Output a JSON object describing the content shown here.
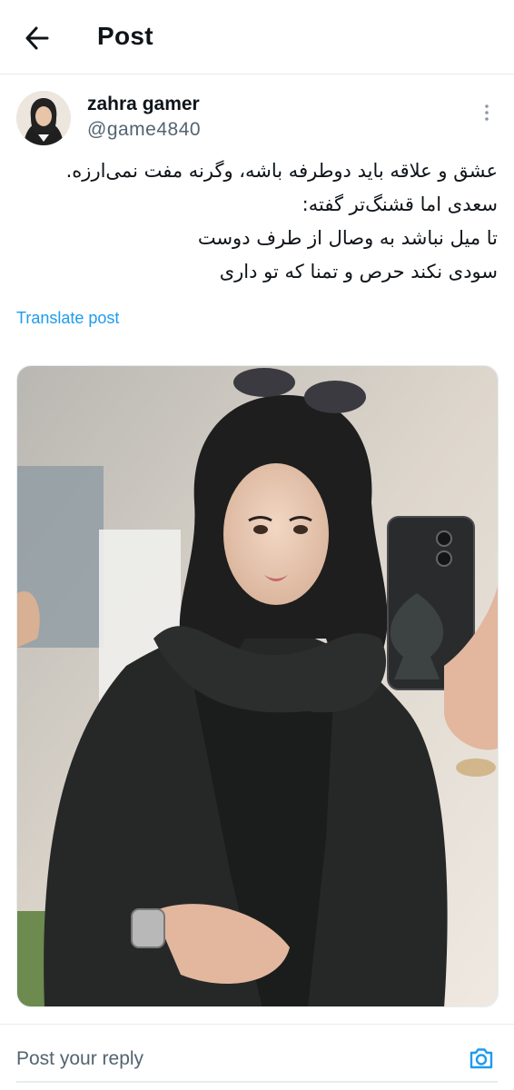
{
  "header": {
    "title": "Post",
    "back_icon": "arrow-left-icon"
  },
  "author": {
    "display_name": "zahra gamer",
    "handle": "@game4840",
    "avatar": "profile-avatar",
    "more_icon": "more-vertical-icon"
  },
  "post": {
    "lines": [
      "عشق و علاقه باید دوطرفه باشه، وگرنه مفت نمی‌ارزه.",
      "سعدی اما قشنگ‌تر گفته:",
      "تا میل نباشد به وصال از طرف دوست",
      "سودی نکند حرص و تمنا که تو داری"
    ],
    "translate_label": "Translate post",
    "media": "photo-woman-mirror-selfie"
  },
  "reply": {
    "placeholder": "Post your reply",
    "camera_icon": "camera-icon"
  },
  "colors": {
    "link": "#1d9bf0",
    "secondary_text": "#536471",
    "border": "#e6ecf0"
  }
}
